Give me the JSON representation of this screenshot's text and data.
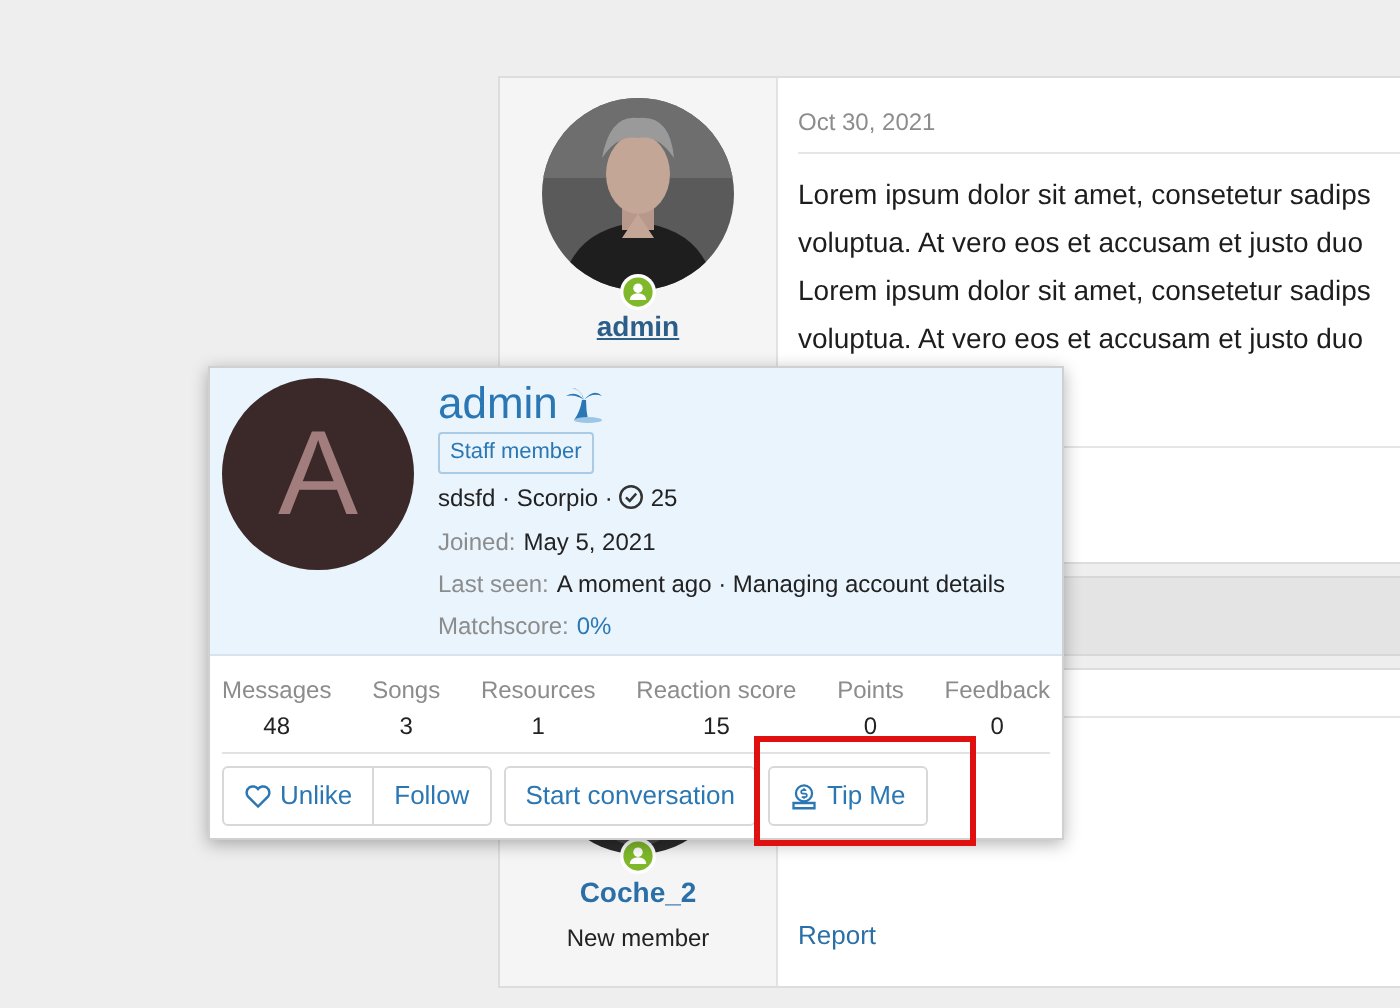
{
  "posts": [
    {
      "author": "admin",
      "online": true,
      "date": "Oct 30, 2021",
      "lines": [
        "Lorem ipsum dolor sit amet, consetetur sadips",
        "voluptua. At vero eos et accusam et justo duo",
        "Lorem ipsum dolor sit amet, consetetur sadips",
        "voluptua. At vero eos et accusam et justo duo"
      ]
    },
    {
      "author": "Coche_2",
      "role": "New member",
      "online": true,
      "action": "Report"
    }
  ],
  "popup": {
    "initial": "A",
    "name": "admin",
    "badge": "Staff member",
    "info": [
      "sdsfd · Scorpio ·",
      "25"
    ],
    "joined": {
      "label": "Joined:",
      "value": "May 5, 2021"
    },
    "last_seen": {
      "label": "Last seen:",
      "value": "A moment ago · Managing account details"
    },
    "matchscore": {
      "label": "Matchscore:",
      "value": "0%"
    },
    "stats": [
      {
        "label": "Messages",
        "value": "48"
      },
      {
        "label": "Songs",
        "value": "3"
      },
      {
        "label": "Resources",
        "value": "1"
      },
      {
        "label": "Reaction score",
        "value": "15"
      },
      {
        "label": "Points",
        "value": "0"
      },
      {
        "label": "Feedback",
        "value": "0"
      }
    ],
    "buttons": [
      {
        "label": "Unlike",
        "kind": "like"
      },
      {
        "label": "Follow",
        "kind": "plain"
      },
      {
        "label": "Start conversation",
        "kind": "plain"
      },
      {
        "label": "Tip Me",
        "kind": "tip"
      }
    ]
  }
}
